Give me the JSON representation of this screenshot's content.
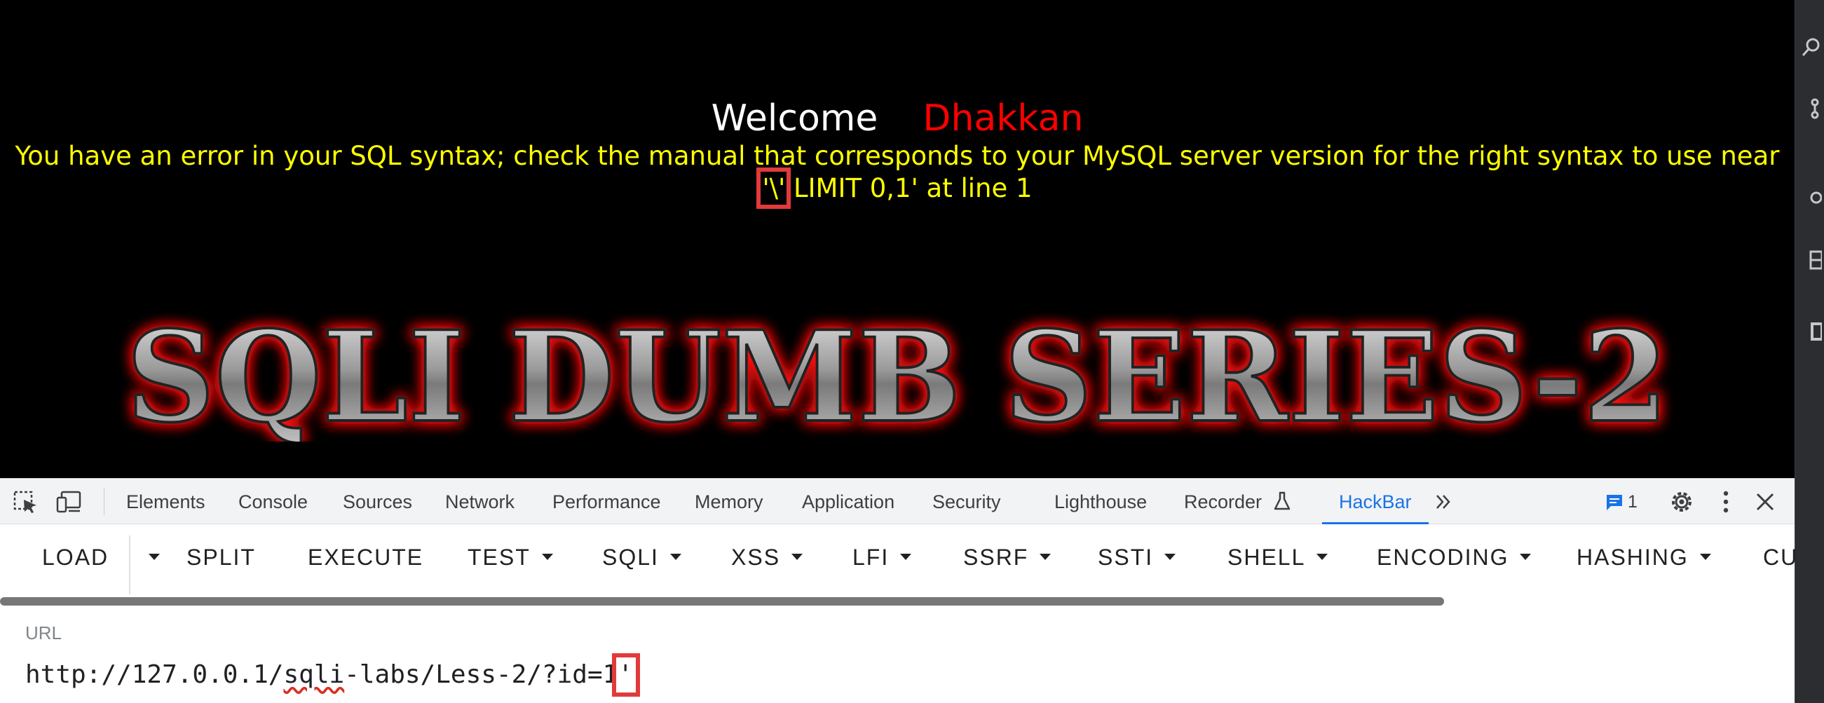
{
  "page": {
    "welcome_label": "Welcome",
    "username": "Dhakkan",
    "error_pre": "You have an error in your SQL syntax; check the manual that corresponds to your MySQL server version for the right syntax to use near ",
    "error_highlight": "'\\'",
    "error_post": " LIMIT 0,1' at line 1",
    "banner_text": "SQLI DUMB SERIES-2"
  },
  "devtools": {
    "tabs": [
      "Elements",
      "Console",
      "Sources",
      "Network",
      "Performance",
      "Memory",
      "Application",
      "Security",
      "Lighthouse",
      "Recorder",
      "HackBar"
    ],
    "active_tab": "HackBar",
    "more_tabs_icon": "double-chevron-right-icon",
    "issues_count": "1",
    "icons": [
      "inspect-element-icon",
      "device-toggle-icon",
      "flask-icon",
      "message-icon",
      "settings-gear-icon",
      "more-vertical-icon",
      "close-icon"
    ]
  },
  "hackbar": {
    "buttons": [
      {
        "label": "LOAD",
        "dropdown": false
      },
      {
        "label": "SPLIT",
        "dropdown": false
      },
      {
        "label": "EXECUTE",
        "dropdown": false
      },
      {
        "label": "TEST",
        "dropdown": true
      },
      {
        "label": "SQLI",
        "dropdown": true
      },
      {
        "label": "XSS",
        "dropdown": true
      },
      {
        "label": "LFI",
        "dropdown": true
      },
      {
        "label": "SSRF",
        "dropdown": true
      },
      {
        "label": "SSTI",
        "dropdown": true
      },
      {
        "label": "SHELL",
        "dropdown": true
      },
      {
        "label": "ENCODING",
        "dropdown": true
      },
      {
        "label": "HASHING",
        "dropdown": true
      },
      {
        "label": "CU",
        "dropdown": false
      }
    ],
    "url_label": "URL",
    "url_parts": [
      "http://127.0.0.1/",
      "sqli",
      "-labs/Less-2/?id=1",
      "'"
    ]
  }
}
